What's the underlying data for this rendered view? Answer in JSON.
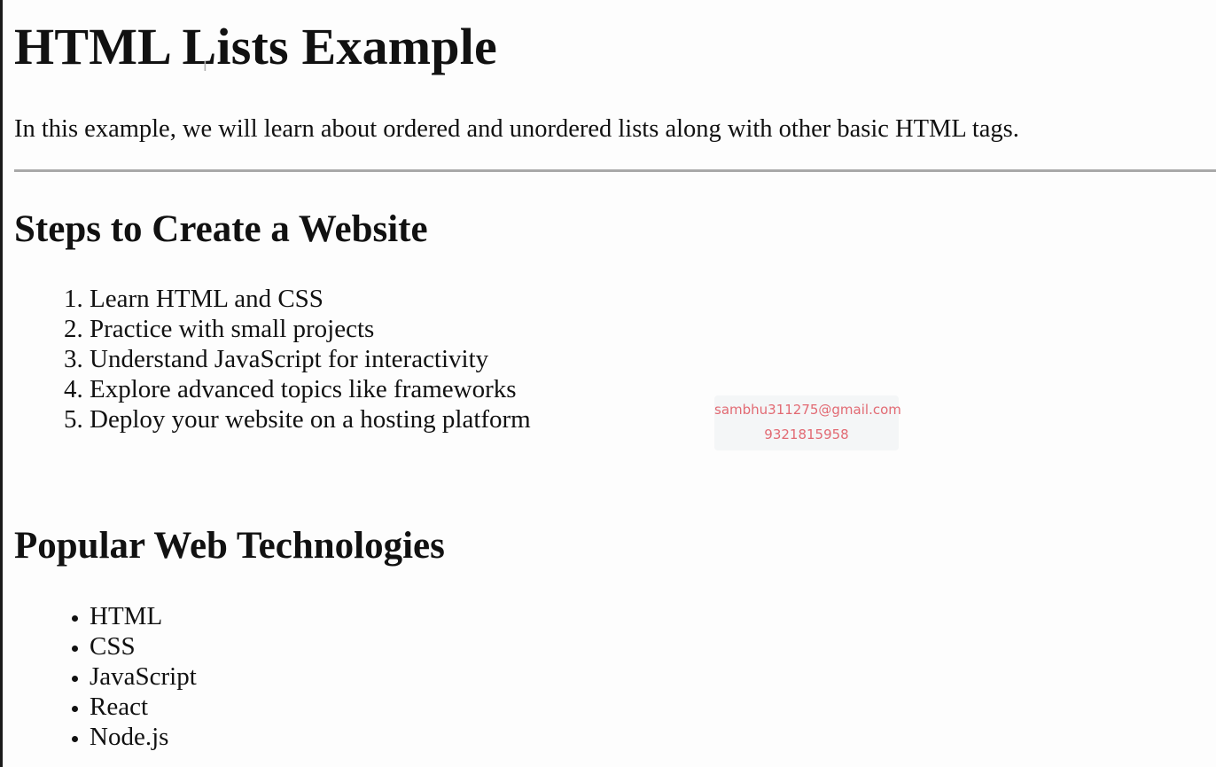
{
  "heading": "HTML Lists Example",
  "intro": "In this example, we will learn about ordered and unordered lists along with other basic HTML tags.",
  "sections": {
    "steps": {
      "title": "Steps to Create a Website",
      "items": [
        "Learn HTML and CSS",
        "Practice with small projects",
        "Understand JavaScript for interactivity",
        "Explore advanced topics like frameworks",
        "Deploy your website on a hosting platform"
      ]
    },
    "technologies": {
      "title": "Popular Web Technologies",
      "items": [
        "HTML",
        "CSS",
        "JavaScript",
        "React",
        "Node.js"
      ]
    }
  },
  "watermark": {
    "email": "sambhu311275@gmail.com",
    "phone": "9321815958"
  },
  "cursor_icon": "text-cursor-icon",
  "colors": {
    "watermark_text": "#e26a73",
    "rule": "#a9a9a9"
  }
}
